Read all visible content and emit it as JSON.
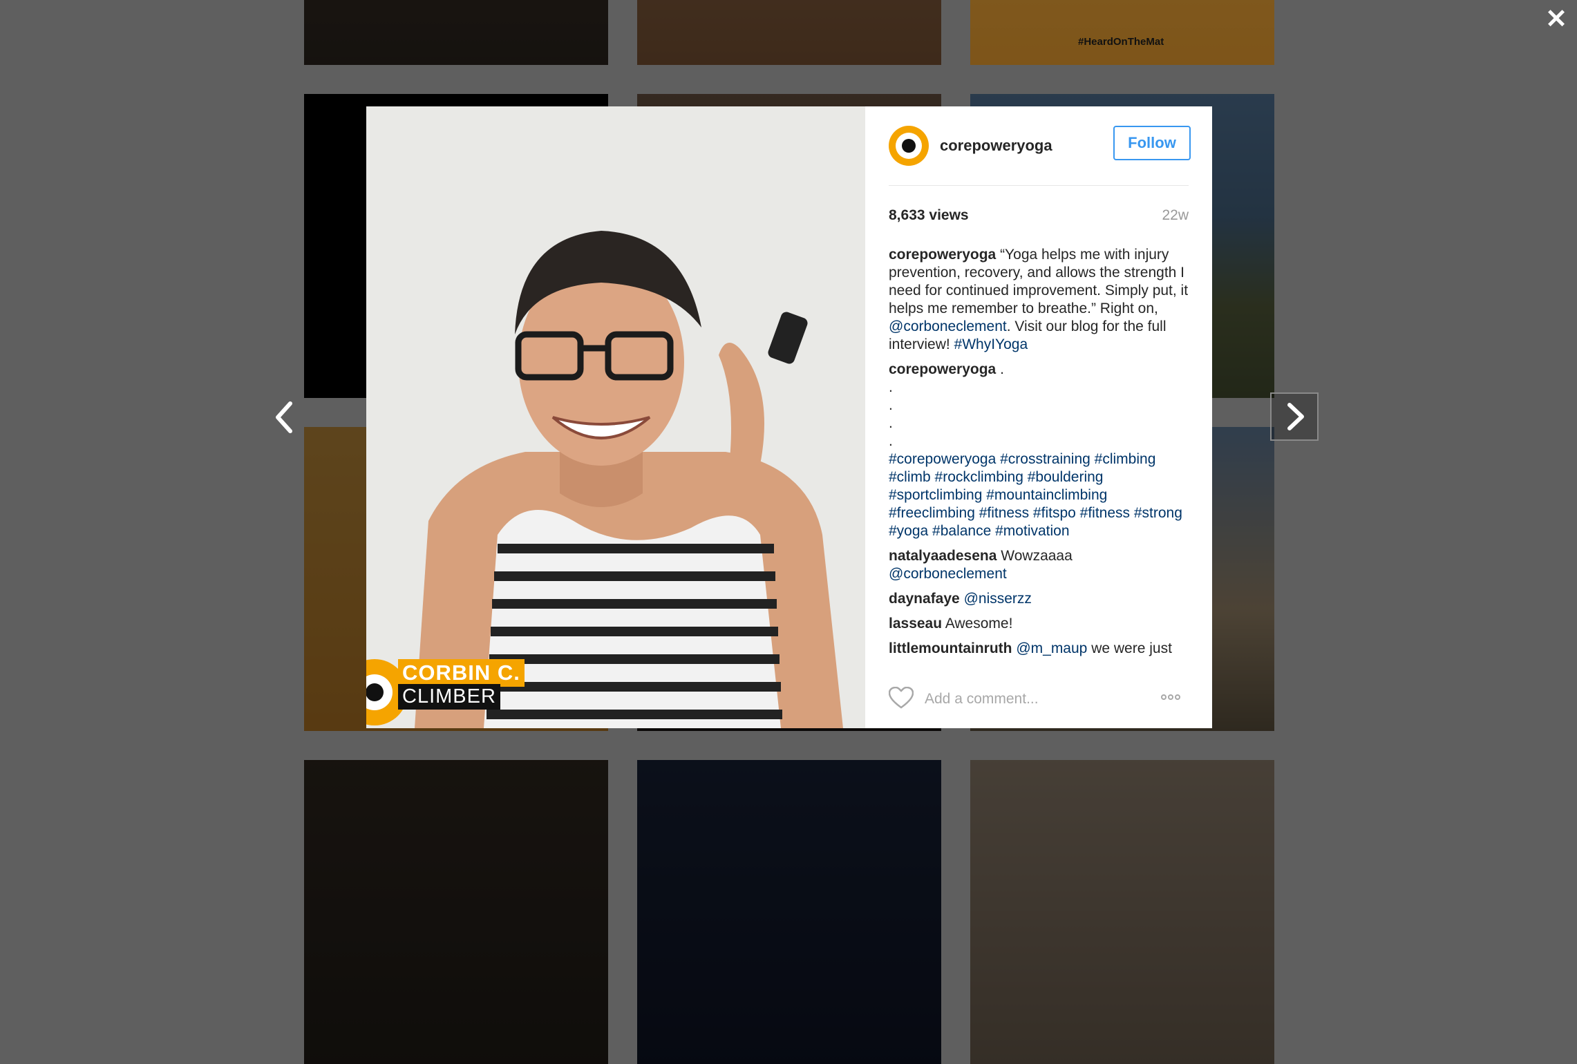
{
  "background_grid": {
    "corner_hashtag": "#HeardOnTheMat"
  },
  "post": {
    "username": "corepoweryoga",
    "follow_label": "Follow",
    "views": "8,633 views",
    "age": "22w",
    "caption": {
      "user": "corepoweryoga",
      "text": "“Yoga helps me with injury prevention, recovery, and allows the strength I need for continued improvement. Simply put, it helps me remember to breathe.” Right on, ",
      "mention": "@corboneclement",
      "text2": ". Visit our blog for the full interview! ",
      "tag": "#WhyIYoga"
    },
    "second_comment": {
      "user": "corepoweryoga",
      "dots": ".",
      "dot_lines": [
        ".",
        ".",
        ".",
        "."
      ],
      "hashtags": "#corepoweryoga #crosstraining #climbing #climb #rockclimbing #bouldering #sportclimbing #mountainclimbing #freeclimbing #fitness #fitspo #fitness #strong #yoga #balance #motivation"
    },
    "comments": [
      {
        "user": "natalyaadesena",
        "text": "Wowzaaaa ",
        "mention": "@corboneclement"
      },
      {
        "user": "daynafaye",
        "text": "",
        "mention": "@nisserzz"
      },
      {
        "user": "lasseau",
        "text": "Awesome!",
        "mention": ""
      },
      {
        "user": "littlemountainruth",
        "text": " we were just",
        "mention": "@m_maup"
      }
    ],
    "add_comment_placeholder": "Add a comment...",
    "media_badge": {
      "name": "CORBIN C.",
      "role": "CLIMBER"
    }
  },
  "colors": {
    "accent": "#3897f0",
    "brand": "#f5a400",
    "link": "#003569"
  },
  "icons": [
    "close-icon",
    "chevron-left-icon",
    "chevron-right-icon",
    "heart-icon",
    "more-options-icon"
  ]
}
